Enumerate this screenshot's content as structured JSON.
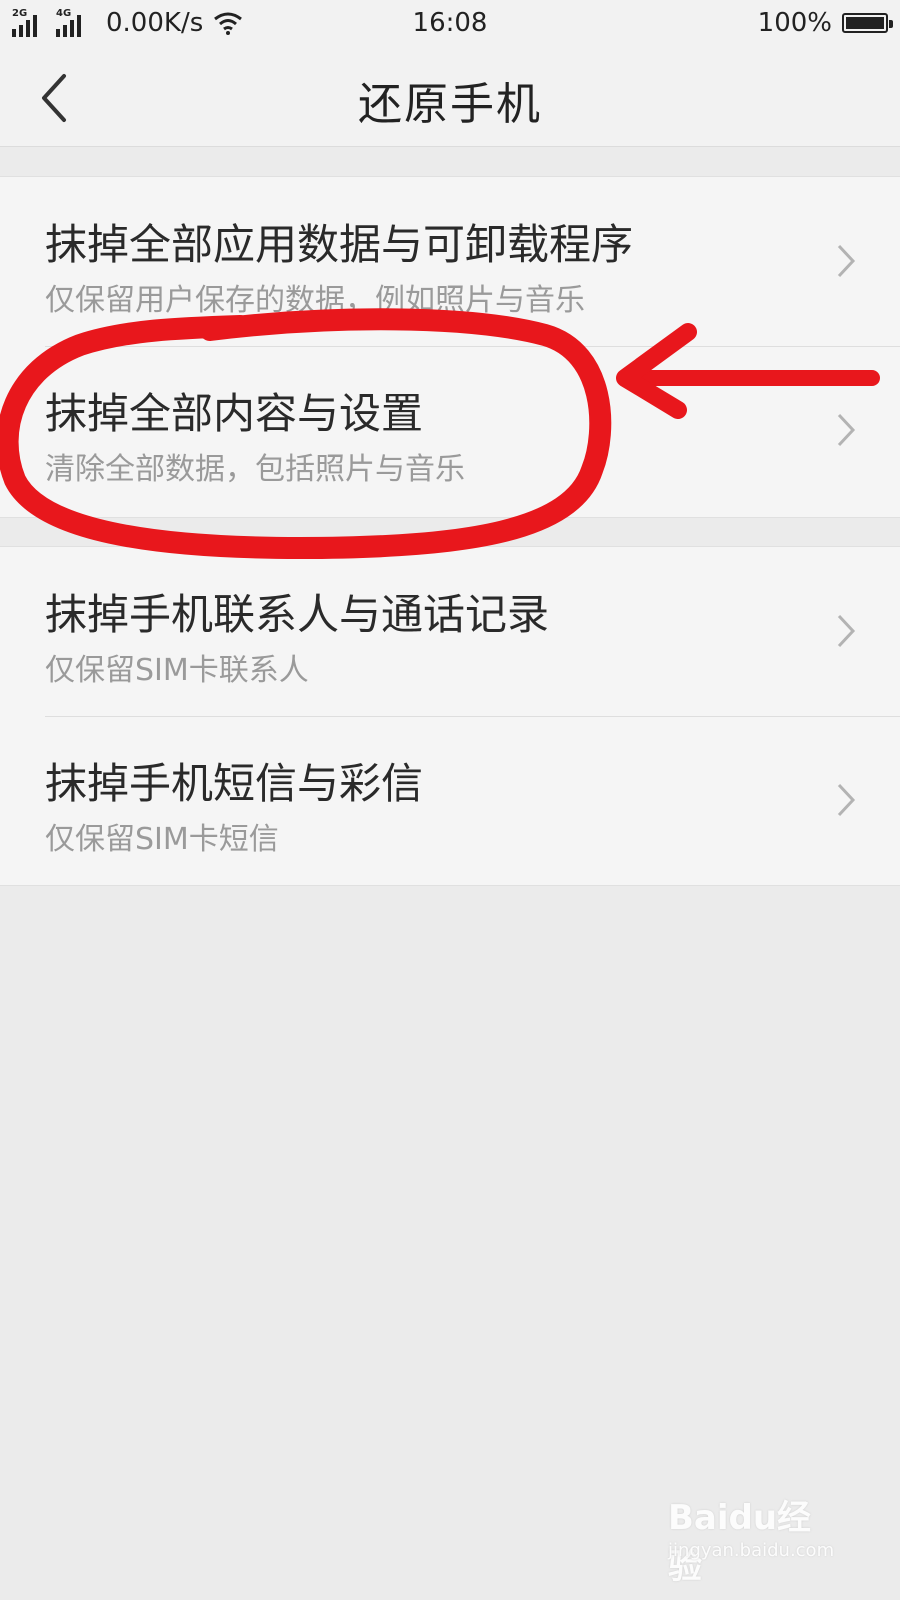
{
  "status_bar": {
    "signal_1_label": "2G",
    "signal_2_label": "4G",
    "net_speed": "0.00K/s",
    "time": "16:08",
    "battery_percent": "100%",
    "battery_level": 1.0,
    "icons": [
      "signal-icon",
      "signal-icon",
      "wifi-icon",
      "battery-icon"
    ]
  },
  "header": {
    "title": "还原手机",
    "back_icon": "chevron-left-icon"
  },
  "groups": [
    {
      "items": [
        {
          "title": "抹掉全部应用数据与可卸载程序",
          "subtitle": "仅保留用户保存的数据，例如照片与音乐"
        },
        {
          "title": "抹掉全部内容与设置",
          "subtitle": "清除全部数据，包括照片与音乐"
        }
      ]
    },
    {
      "items": [
        {
          "title": "抹掉手机联系人与通话记录",
          "subtitle": "仅保留SIM卡联系人"
        },
        {
          "title": "抹掉手机短信与彩信",
          "subtitle": "仅保留SIM卡短信"
        }
      ]
    }
  ],
  "annotation": {
    "color": "#e8171c",
    "shapes": [
      "red-circle",
      "red-arrow"
    ]
  },
  "watermark": {
    "logo": "Baidu经验",
    "url": "jingyan.baidu.com"
  },
  "colors": {
    "background": "#ebebeb",
    "card": "#f5f5f5",
    "title_text": "#2a2a2a",
    "subtitle_text": "#9a9a9a"
  }
}
